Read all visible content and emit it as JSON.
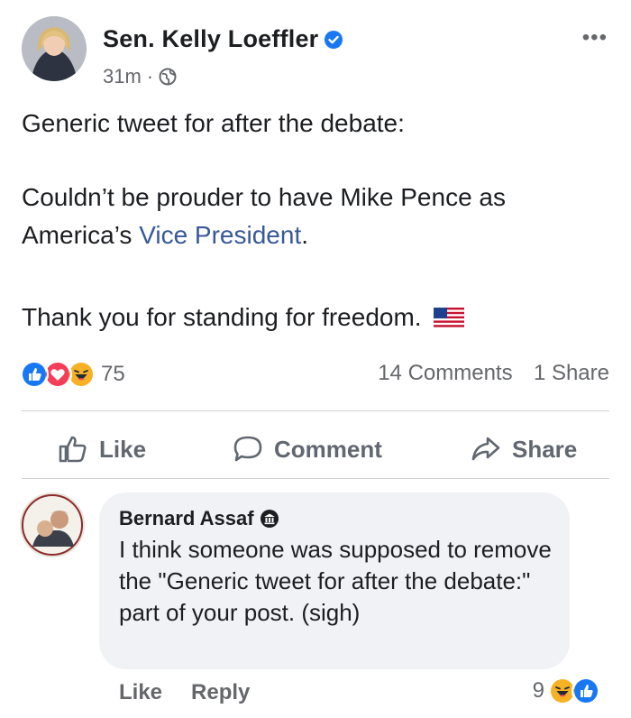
{
  "post": {
    "author": "Sen. Kelly Loeffler",
    "time": "31m",
    "separator": "·",
    "more_menu": "•••",
    "line1": "Generic tweet for after the debate:",
    "line2a": "Couldn’t be prouder to have Mike Pence as",
    "line2b_prefix": "America’s ",
    "line2b_link": "Vice President",
    "line2b_suffix": ".",
    "line3": "Thank you for standing for freedom.",
    "reaction_count": "75",
    "comments_count": "14 Comments",
    "shares_count": "1 Share"
  },
  "actions": {
    "like": "Like",
    "comment": "Comment",
    "share": "Share"
  },
  "comment": {
    "author": "Bernard Assaf",
    "text": "I think someone was supposed to remove the \"Generic tweet for after the debate:\" part of your post. (sigh)",
    "like": "Like",
    "reply": "Reply",
    "reaction_count": "9"
  },
  "icons": {
    "verified": "verified-badge-icon",
    "audience": "globe-icon",
    "reactions": [
      "like-reaction-icon",
      "love-reaction-icon",
      "haha-reaction-icon"
    ],
    "flag": "us-flag-emoji"
  },
  "colors": {
    "facebook_blue": "#1877f2",
    "link_blue": "#385898",
    "love_red": "#f33e58",
    "haha_yellow": "#f7b125",
    "secondary_text": "#65676b"
  }
}
